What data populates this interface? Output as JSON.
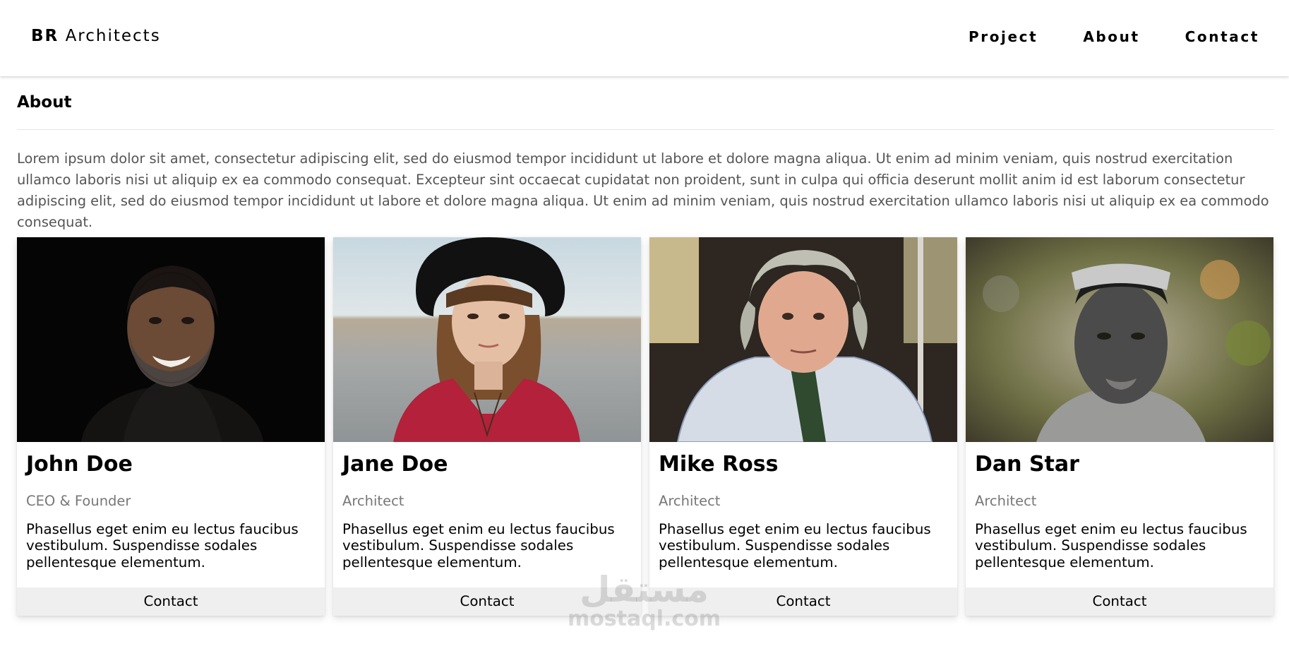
{
  "header": {
    "brand_bold": "BR",
    "brand_light": "Architects",
    "nav": [
      {
        "label": "Project"
      },
      {
        "label": "About"
      },
      {
        "label": "Contact"
      }
    ]
  },
  "about": {
    "title": "About",
    "text": "Lorem ipsum dolor sit amet, consectetur adipiscing elit, sed do eiusmod tempor incididunt ut labore et dolore magna aliqua. Ut enim ad minim veniam, quis nostrud exercitation ullamco laboris nisi ut aliquip ex ea commodo consequat. Excepteur sint occaecat cupidatat non proident, sunt in culpa qui officia deserunt mollit anim id est laborum consectetur adipiscing elit, sed do eiusmod tempor incididunt ut labore et dolore magna aliqua. Ut enim ad minim veniam, quis nostrud exercitation ullamco laboris nisi ut aliquip ex ea commodo consequat."
  },
  "team": [
    {
      "name": "John Doe",
      "role": "CEO & Founder",
      "bio": "Phasellus eget enim eu lectus faucibus vestibulum. Suspendisse sodales pellentesque elementum.",
      "button": "Contact",
      "photo_icon": "portrait-photo-man-beard"
    },
    {
      "name": "Jane Doe",
      "role": "Architect",
      "bio": "Phasellus eget enim eu lectus faucibus vestibulum. Suspendisse sodales pellentesque elementum.",
      "button": "Contact",
      "photo_icon": "portrait-photo-woman-hat"
    },
    {
      "name": "Mike Ross",
      "role": "Architect",
      "bio": "Phasellus eget enim eu lectus faucibus vestibulum. Suspendisse sodales pellentesque elementum.",
      "button": "Contact",
      "photo_icon": "portrait-photo-older-man"
    },
    {
      "name": "Dan Star",
      "role": "Architect",
      "bio": "Phasellus eget enim eu lectus faucibus vestibulum. Suspendisse sodales pellentesque elementum.",
      "button": "Contact",
      "photo_icon": "portrait-photo-young-man"
    }
  ],
  "watermark": {
    "arabic": "مستقل",
    "latin": "mostaql.com"
  },
  "colors": {
    "text": "#000000",
    "muted": "#777777",
    "body_text": "#555555",
    "button_bg": "#efefef",
    "divider": "#e5e5e5"
  }
}
